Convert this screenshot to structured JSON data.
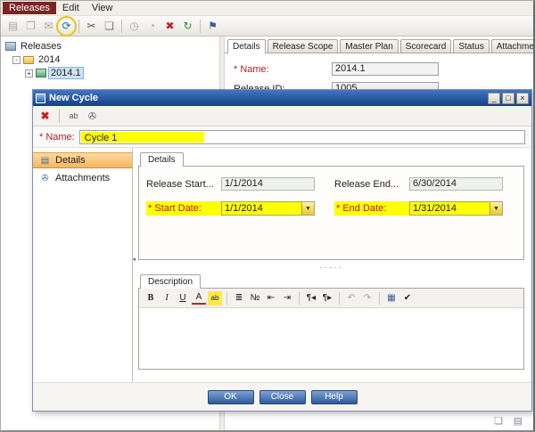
{
  "colors": {
    "menu_active_bg": "#7b2424",
    "highlight_yellow": "#ffff00",
    "required_red": "#b02020",
    "sidebar_selected_bg": "#f6b75e",
    "button_blue": "#2e5b9b",
    "titlebar_blue": "#153e86"
  },
  "menu": {
    "items": [
      "Releases",
      "Edit",
      "View"
    ]
  },
  "toolbar": {
    "icons": [
      {
        "name": "new-release-folder-icon",
        "glyph": "▤"
      },
      {
        "name": "new-release-icon",
        "glyph": "❐"
      },
      {
        "name": "mail-icon",
        "glyph": "✉"
      },
      {
        "name": "new-cycle-icon",
        "glyph": "⟳",
        "highlighted": true
      },
      {
        "name": "cut-icon",
        "glyph": "✂"
      },
      {
        "name": "paste-icon",
        "glyph": "❏"
      },
      {
        "name": "time-icon",
        "glyph": "◷"
      },
      {
        "name": "history-icon",
        "glyph": "◔"
      },
      {
        "name": "delete-icon",
        "glyph": "✖"
      },
      {
        "name": "refresh-icon",
        "glyph": "↻"
      },
      {
        "name": "flag-icon",
        "glyph": "⚑"
      }
    ]
  },
  "tree": {
    "items": [
      {
        "label": "Releases"
      },
      {
        "label": "2014",
        "toggle": "-"
      },
      {
        "label": "2014.1",
        "toggle": "+",
        "selected": true
      }
    ],
    "icon_shapes": {
      "releases-root-icon": "cabinet",
      "release-folder-icon": "folder",
      "release-icon": "release"
    }
  },
  "release_details": {
    "tabs": [
      "Details",
      "Release Scope",
      "Master Plan",
      "Scorecard",
      "Status",
      "Attachments"
    ],
    "active_tab": "Details",
    "name_label": "* Name:",
    "name_value": "2014.1",
    "release_id_label": "Release ID:",
    "release_id_value": "1005"
  },
  "dialog": {
    "title": "New Cycle",
    "window_buttons": {
      "minimize": "_",
      "maximize": "□",
      "close": "×"
    },
    "toolbar": {
      "clear_glyph": "✖",
      "spell_glyph": "ab",
      "attach_glyph": "✇"
    },
    "name_label": "* Name:",
    "name_value": "Cycle 1",
    "sidebar": {
      "items": [
        "Details",
        "Attachments"
      ],
      "selected": "Details",
      "details_icon_glyph": "▤",
      "attachments_icon_glyph": "✇",
      "collapse_glyph": "◂"
    },
    "details_tab": "Details",
    "fields": {
      "release_start_label": "Release Start...",
      "release_start_value": "1/1/2014",
      "release_end_label": "Release End...",
      "release_end_value": "6/30/2014",
      "start_date_label": "* Start Date:",
      "start_date_value": "1/1/2014",
      "end_date_label": "* End Date:",
      "end_date_value": "1/31/2014",
      "combo_arrow": "▼"
    },
    "splitter_dots": "·····",
    "description": {
      "tab": "Description",
      "toolbar": [
        {
          "name": "bold-icon",
          "glyph": "B"
        },
        {
          "name": "italic-icon",
          "glyph": "I"
        },
        {
          "name": "underline-icon",
          "glyph": "U"
        },
        {
          "name": "font-color-icon",
          "glyph": "A"
        },
        {
          "name": "highlight-icon",
          "glyph": "ab"
        },
        {
          "name": "bullet-list-icon",
          "glyph": "≣"
        },
        {
          "name": "numbered-list-icon",
          "glyph": "№"
        },
        {
          "name": "outdent-icon",
          "glyph": "⇤"
        },
        {
          "name": "indent-icon",
          "glyph": "⇥"
        },
        {
          "name": "ltr-paragraph-icon",
          "glyph": "¶◂"
        },
        {
          "name": "rtl-paragraph-icon",
          "glyph": "¶▸"
        },
        {
          "name": "undo-icon",
          "glyph": "↶"
        },
        {
          "name": "redo-icon",
          "glyph": "↷"
        },
        {
          "name": "table-icon",
          "glyph": "▦"
        },
        {
          "name": "spelling-icon",
          "glyph": "✔"
        }
      ]
    },
    "buttons": [
      "OK",
      "Close",
      "Help"
    ]
  },
  "status_icons": [
    {
      "name": "doc-panel-icon",
      "glyph": "❏"
    },
    {
      "name": "grid-panel-icon",
      "glyph": "▤"
    }
  ]
}
